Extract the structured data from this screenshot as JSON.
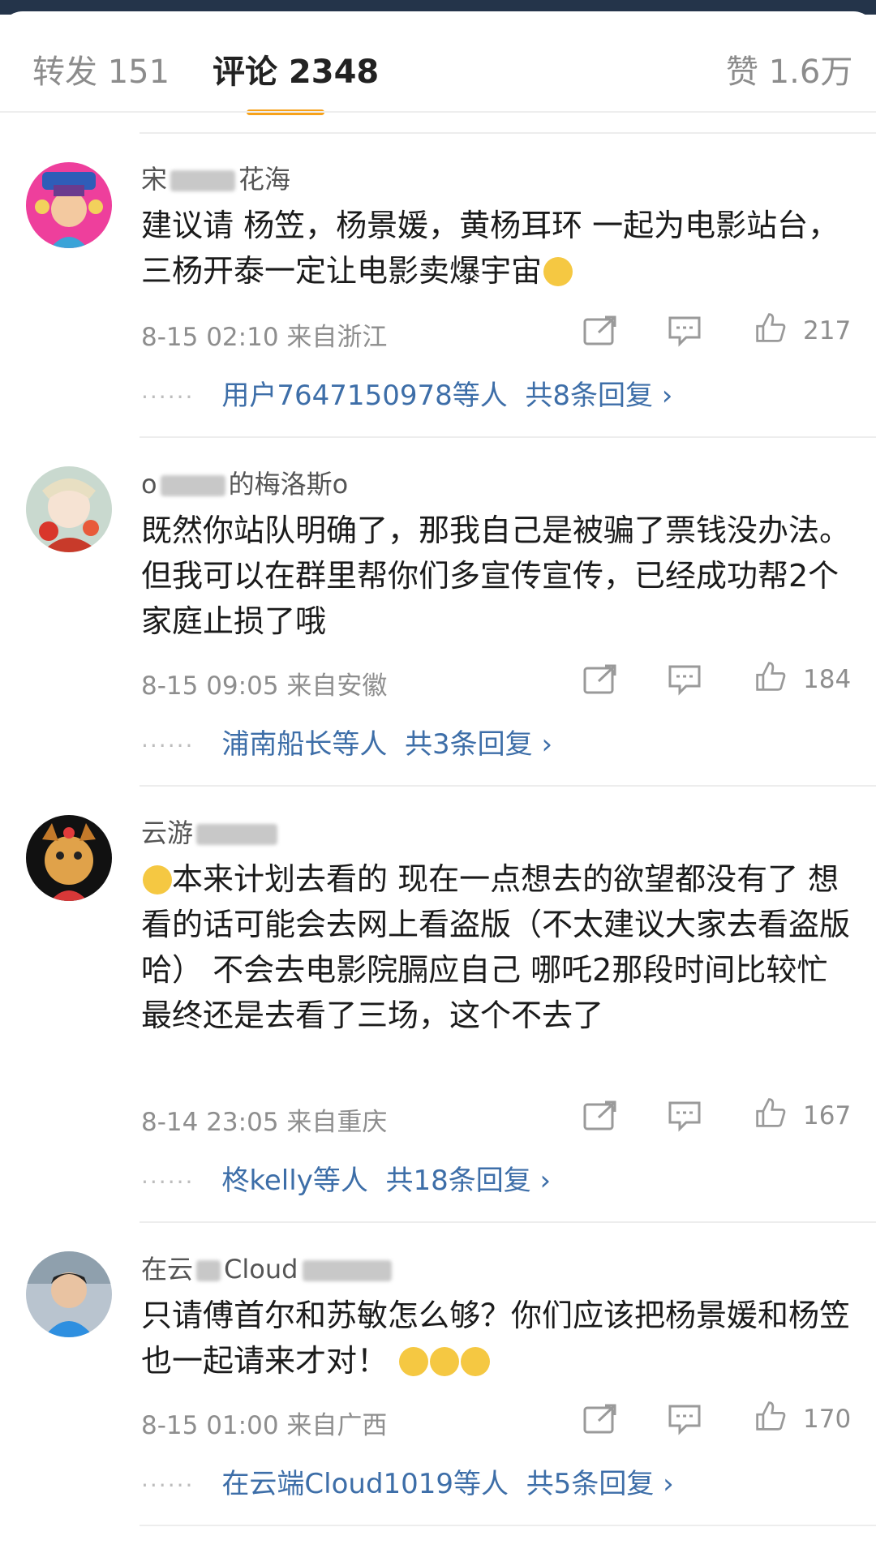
{
  "tabs": {
    "repost": "转发 151",
    "comments": "评论 2348",
    "likes": "赞 1.6万"
  },
  "comments": [
    {
      "name": "宋",
      "name_tail": "花海",
      "text": "建议请 杨笠，杨景媛，黄杨耳环 一起为电影站台，三杨开泰一定让电影卖爆宇宙",
      "time": "8-15 02:10 来自浙江",
      "likes": "217",
      "replies_dots": "······",
      "replies_users": "用户7647150978等人",
      "replies_count": "共8条回复 ›"
    },
    {
      "name": "o",
      "name_tail": "的梅洛斯o",
      "text": "既然你站队明确了，那我自己是被骗了票钱没办法。但我可以在群里帮你们多宣传宣传，已经成功帮2个家庭止损了哦",
      "time": "8-15 09:05 来自安徽",
      "likes": "184",
      "replies_dots": "······",
      "replies_users": "浦南船长等人",
      "replies_count": "共3条回复 ›"
    },
    {
      "name": "云游",
      "name_tail": "",
      "text": "本来计划去看的 现在一点想去的欲望都没有了 想看的话可能会去网上看盗版（不太建议大家去看盗版哈） 不会去电影院膈应自己 哪吒2那段时间比较忙最终还是去看了三场，这个不去了",
      "time": "8-14 23:05 来自重庆",
      "likes": "167",
      "replies_dots": "······",
      "replies_users": "柊kelly等人",
      "replies_count": "共18条回复 ›"
    },
    {
      "name": "在云",
      "name_tail": "Cloud",
      "text": "只请傅首尔和苏敏怎么够？你们应该把杨景媛和杨笠也一起请来才对！",
      "time": "8-15 01:00 来自广西",
      "likes": "170",
      "replies_dots": "······",
      "replies_users": "在云端Cloud1019等人",
      "replies_count": "共5条回复 ›"
    }
  ]
}
